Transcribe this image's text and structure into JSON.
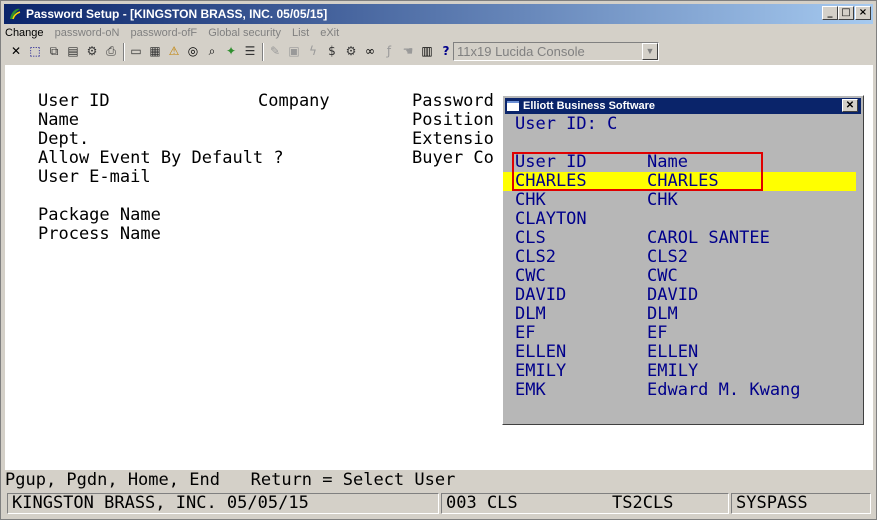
{
  "window": {
    "title": "Password Setup - [KINGSTON BRASS, INC. 05/05/15]",
    "controls": [
      "_",
      "□",
      "×"
    ]
  },
  "menu": [
    {
      "label": "Change",
      "enabled": true
    },
    {
      "label": "password-oN",
      "enabled": false
    },
    {
      "label": "password-ofF",
      "enabled": false
    },
    {
      "label": "Global security",
      "enabled": false
    },
    {
      "label": "List",
      "enabled": false
    },
    {
      "label": "eXit",
      "enabled": false
    }
  ],
  "toolbar": {
    "font_value": "11x19 Lucida Console"
  },
  "form": {
    "user_id_label": "User ID",
    "company_label": "Company",
    "password_label": "Password",
    "name_label": "Name",
    "position_label": "Position",
    "dept_label": "Dept.",
    "extension_label": "Extensio",
    "allow_event_label": "Allow Event By Default ?",
    "buyer_label": "Buyer Co",
    "email_label": "User E-mail",
    "package_label": "Package Name",
    "process_label": "Process Name"
  },
  "status_line": "Pgup, Pgdn, Home, End   Return = Select User",
  "bottom": {
    "company": "KINGSTON BRASS, INC. 05/05/15",
    "session": "003 CLS",
    "terminal": "TS2CLS",
    "program": "SYSPASS"
  },
  "lookup": {
    "title": "Elliott Business Software",
    "search_line": "User ID: C",
    "col_user_id": "User ID",
    "col_name": "Name",
    "selected_index": 0,
    "rows": [
      {
        "id": "CHARLES",
        "name": "CHARLES"
      },
      {
        "id": "CHK",
        "name": "CHK"
      },
      {
        "id": "CLAYTON",
        "name": ""
      },
      {
        "id": "CLS",
        "name": "CAROL SANTEE"
      },
      {
        "id": "CLS2",
        "name": "CLS2"
      },
      {
        "id": "CWC",
        "name": "CWC"
      },
      {
        "id": "DAVID",
        "name": "DAVID"
      },
      {
        "id": "DLM",
        "name": "DLM"
      },
      {
        "id": "EF",
        "name": "EF"
      },
      {
        "id": "ELLEN",
        "name": "ELLEN"
      },
      {
        "id": "EMILY",
        "name": "EMILY"
      },
      {
        "id": "EMK",
        "name": "Edward M. Kwang"
      }
    ]
  },
  "colors": {
    "titlebar": "#0a246a",
    "highlight": "#ffff00",
    "callout": "#e00000",
    "list_text": "#00008b"
  }
}
